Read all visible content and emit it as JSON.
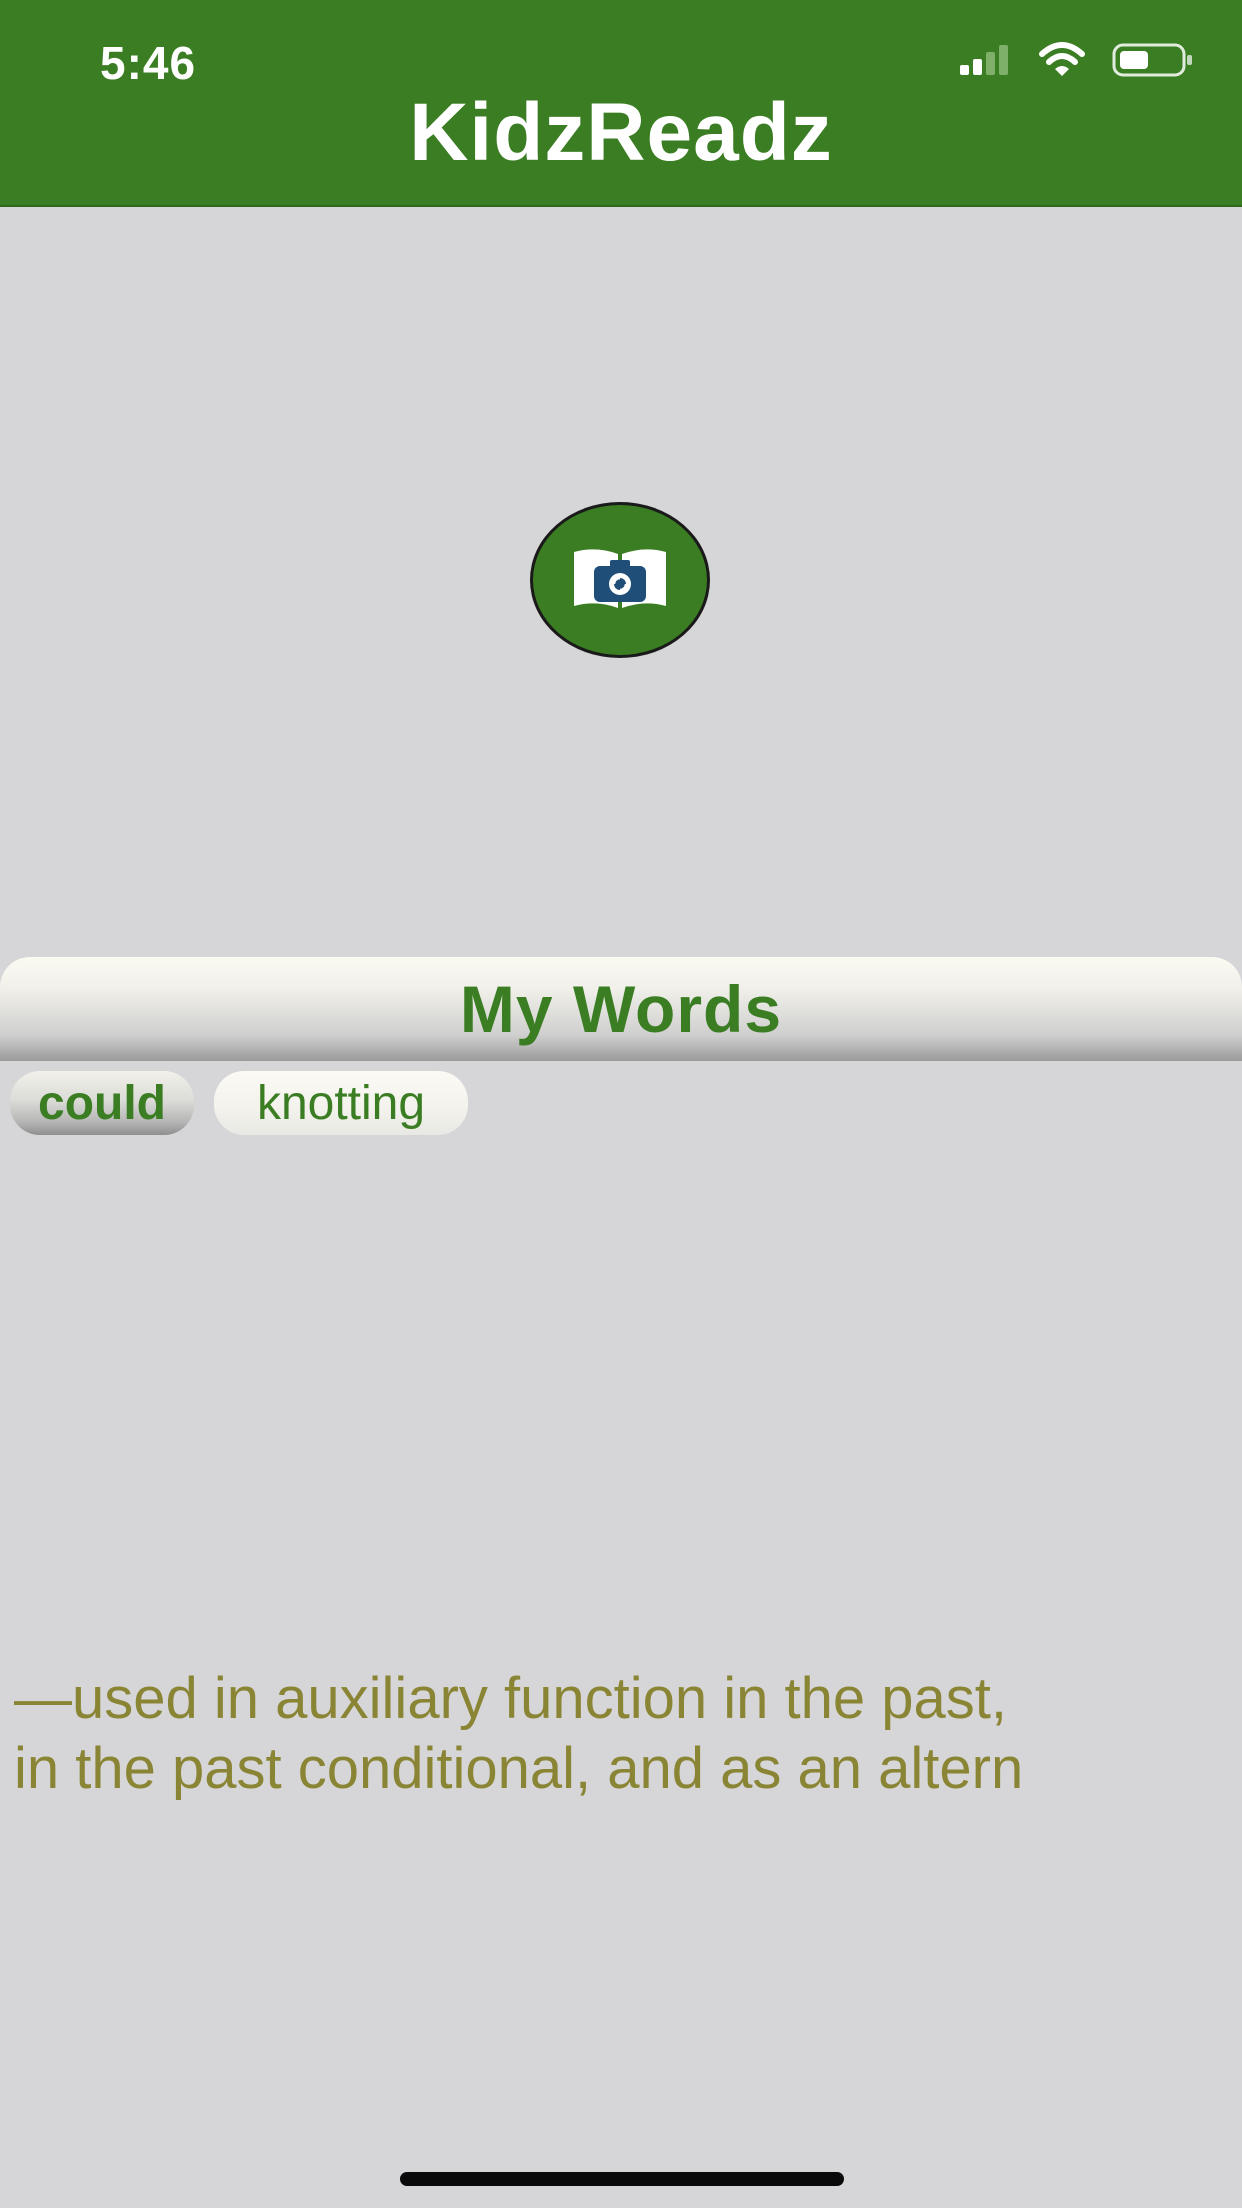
{
  "status_bar": {
    "time": "5:46",
    "icons": [
      "cellular-signal-icon",
      "wifi-icon",
      "battery-icon"
    ]
  },
  "header": {
    "title": "KidzReadz",
    "background_color": "#3a7d22"
  },
  "scan_button": {
    "icon": "book-camera-icon",
    "accent": "#3a7d22"
  },
  "my_words": {
    "title": "My Words",
    "words": [
      {
        "label": "could",
        "selected": true
      },
      {
        "label": "knotting",
        "selected": false
      }
    ]
  },
  "definition": {
    "lines": [
      "—used in auxiliary function in the past,",
      "in the past conditional, and as an altern"
    ],
    "color": "#8a8534"
  }
}
